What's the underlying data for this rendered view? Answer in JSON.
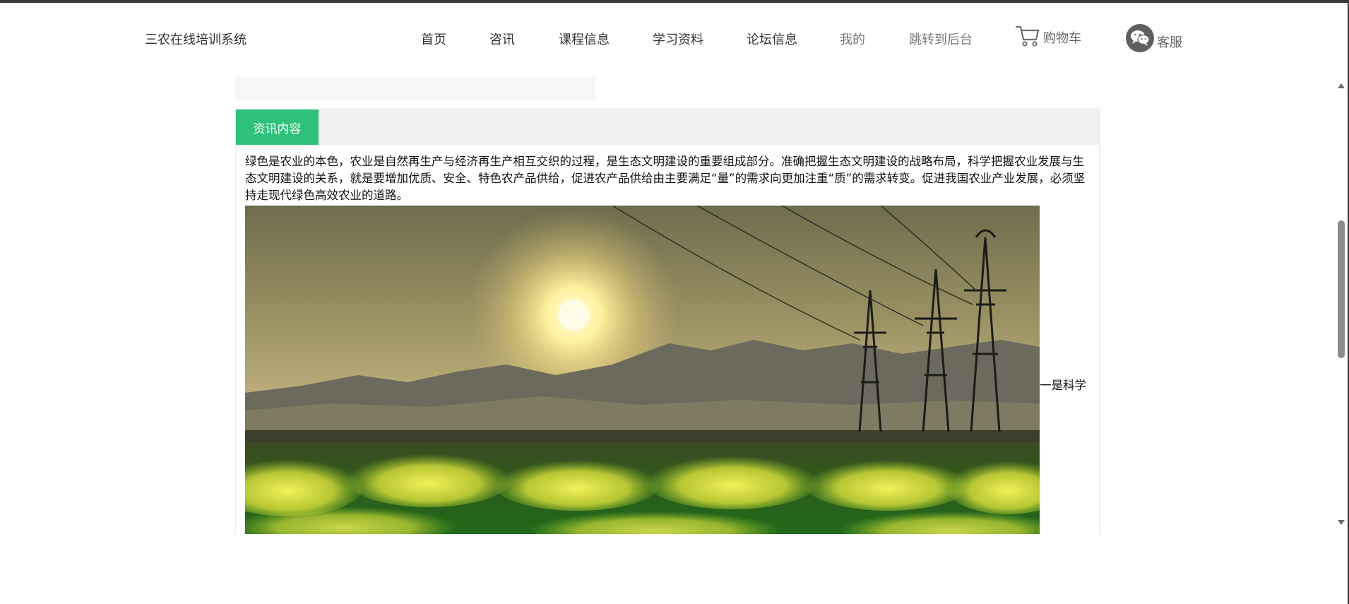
{
  "header": {
    "brand": "三农在线培训系统",
    "nav": [
      {
        "label": "首页"
      },
      {
        "label": "咨讯"
      },
      {
        "label": "课程信息"
      },
      {
        "label": "学习资料"
      },
      {
        "label": "论坛信息"
      },
      {
        "label": "我的"
      },
      {
        "label": "跳转到后台"
      }
    ],
    "cart": {
      "label": "购物车",
      "icon": "cart-icon"
    },
    "service": {
      "label": "客服",
      "icon": "wechat-icon"
    }
  },
  "panel": {
    "tab_label": "资讯内容",
    "tab_color": "#2fc17a",
    "body_text": "绿色是农业的本色，农业是自然再生产与经济再生产相互交织的过程，是生态文明建设的重要组成部分。准确把握生态文明建设的战略布局，科学把握农业发展与生态文明建设的关系，就是要增加优质、安全、特色农产品供给，促进农产品供给由主要满足“量”的需求向更加注重“质”的需求转变。促进我国农业产业发展，必须坚持走现代绿色高效农业的道路。",
    "trailing_text": "一是科学"
  }
}
